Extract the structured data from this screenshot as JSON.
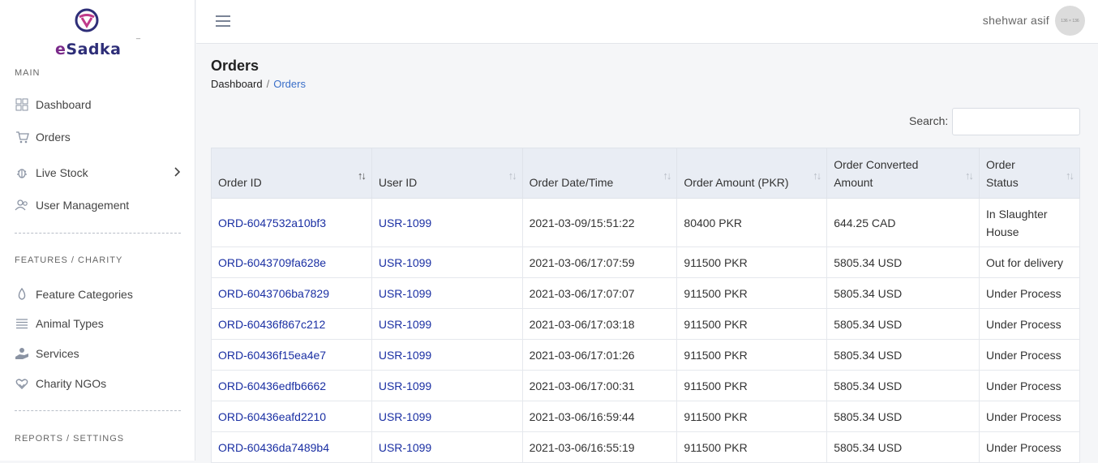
{
  "brand": {
    "logo_e": "e",
    "logo_rest": "Sadka"
  },
  "sidebar": {
    "section_main": "MAIN",
    "section_features": "FEATURES / CHARITY",
    "section_reports": "REPORTS / SETTINGS",
    "items": [
      {
        "label": "Dashboard",
        "icon": "grid-icon"
      },
      {
        "label": "Orders",
        "icon": "cart-icon"
      },
      {
        "label": "Live Stock",
        "icon": "bug-icon"
      },
      {
        "label": "User Management",
        "icon": "users-icon"
      },
      {
        "label": "Feature Categories",
        "icon": "drop-icon"
      },
      {
        "label": "Animal Types",
        "icon": "list-icon"
      },
      {
        "label": "Services",
        "icon": "hand-icon"
      },
      {
        "label": "Charity NGOs",
        "icon": "heart-hand-icon"
      }
    ]
  },
  "topbar": {
    "user_name": "shehwar asif",
    "avatar_text": "136 × 136"
  },
  "page": {
    "title": "Orders",
    "breadcrumb_home": "Dashboard",
    "breadcrumb_sep": "/",
    "breadcrumb_current": "Orders"
  },
  "search": {
    "label": "Search:",
    "value": ""
  },
  "table": {
    "headers": [
      "Order ID",
      "User ID",
      "Order Date/Time",
      "Order Amount (PKR)",
      "Order Converted Amount",
      "Order Status"
    ],
    "rows": [
      [
        "ORD-6047532a10bf3",
        "USR-1099",
        "2021-03-09/15:51:22",
        "80400 PKR",
        "644.25 CAD",
        "In Slaughter House"
      ],
      [
        "ORD-6043709fa628e",
        "USR-1099",
        "2021-03-06/17:07:59",
        "911500 PKR",
        "5805.34 USD",
        "Out for delivery"
      ],
      [
        "ORD-6043706ba7829",
        "USR-1099",
        "2021-03-06/17:07:07",
        "911500 PKR",
        "5805.34 USD",
        "Under Process"
      ],
      [
        "ORD-60436f867c212",
        "USR-1099",
        "2021-03-06/17:03:18",
        "911500 PKR",
        "5805.34 USD",
        "Under Process"
      ],
      [
        "ORD-60436f15ea4e7",
        "USR-1099",
        "2021-03-06/17:01:26",
        "911500 PKR",
        "5805.34 USD",
        "Under Process"
      ],
      [
        "ORD-60436edfb6662",
        "USR-1099",
        "2021-03-06/17:00:31",
        "911500 PKR",
        "5805.34 USD",
        "Under Process"
      ],
      [
        "ORD-60436eafd2210",
        "USR-1099",
        "2021-03-06/16:59:44",
        "911500 PKR",
        "5805.34 USD",
        "Under Process"
      ],
      [
        "ORD-60436da7489b4",
        "USR-1099",
        "2021-03-06/16:55:19",
        "911500 PKR",
        "5805.34 USD",
        "Under Process"
      ]
    ]
  }
}
